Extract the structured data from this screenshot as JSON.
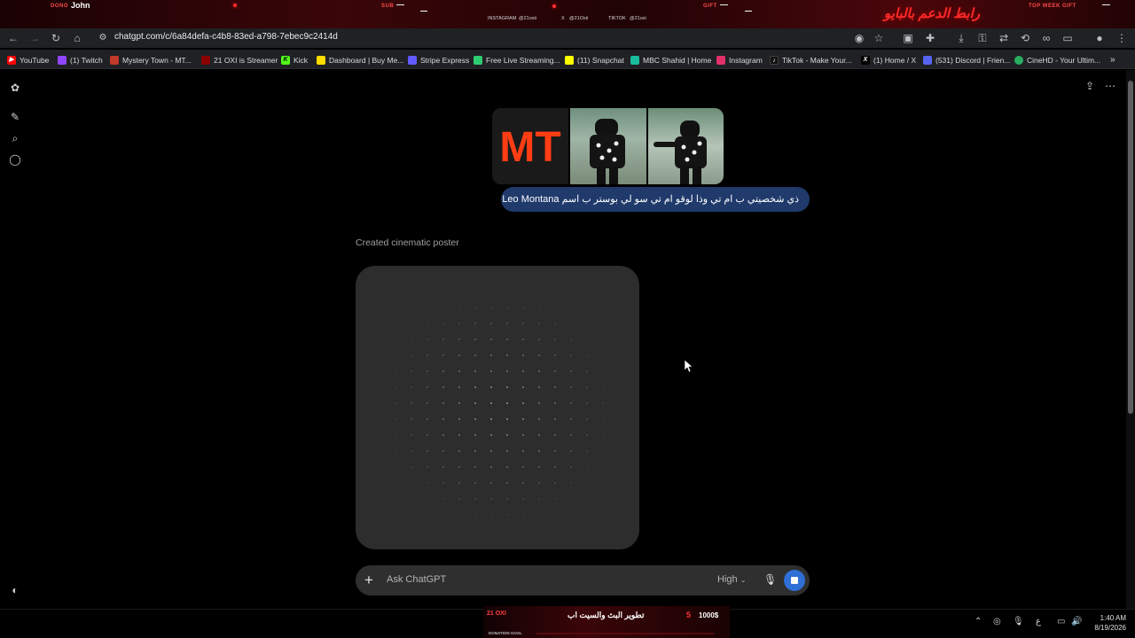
{
  "overlay_top": {
    "items": [
      {
        "label": "DONO",
        "value": "John"
      },
      {
        "label": "SUB",
        "value": "—"
      },
      {
        "label": "GIFT",
        "value": "—"
      },
      {
        "label": "TOP WEEK GIFT",
        "value": "—"
      }
    ],
    "socials": [
      {
        "label": "INSTAGRAM",
        "handle": "@21oxii"
      },
      {
        "label": "X",
        "handle": "@21Oxii"
      },
      {
        "label": "TIKTOK",
        "handle": "@21oxi"
      }
    ],
    "arabic_banner": "رابط الدعم بالبايو"
  },
  "browser": {
    "url": "chatgpt.com/c/6a84defa-c4b8-83ed-a798-7ebec9c2414d",
    "bookmarks": [
      {
        "label": "YouTube",
        "color": "#ff0000",
        "icon": "youtube-icon"
      },
      {
        "label": "(1) Twitch",
        "color": "#9146ff",
        "icon": "twitch-icon"
      },
      {
        "label": "Mystery Town - MT...",
        "color": "#c0392b",
        "icon": "mt-icon"
      },
      {
        "label": "21 OXI is Streamer",
        "color": "#8b0000",
        "icon": "oxi-icon"
      },
      {
        "label": "Kick",
        "color": "#53fc18",
        "icon": "kick-icon"
      },
      {
        "label": "Dashboard | Buy Me...",
        "color": "#ffdd00",
        "icon": "coffee-icon"
      },
      {
        "label": "Stripe Express",
        "color": "#635bff",
        "icon": "stripe-icon"
      },
      {
        "label": "Free Live Streaming...",
        "color": "#2ecc71",
        "icon": "stream-icon"
      },
      {
        "label": "(11) Snapchat",
        "color": "#fffc00",
        "icon": "snapchat-icon"
      },
      {
        "label": "MBC Shahid | Home",
        "color": "#1abc9c",
        "icon": "shahid-icon"
      },
      {
        "label": "Instagram",
        "color": "#e1306c",
        "icon": "instagram-icon"
      },
      {
        "label": "TikTok - Make Your...",
        "color": "#111111",
        "icon": "tiktok-icon"
      },
      {
        "label": "(1) Home / X",
        "color": "#000000",
        "icon": "x-icon"
      },
      {
        "label": "(531) Discord | Frien...",
        "color": "#5865f2",
        "icon": "discord-icon"
      },
      {
        "label": "CineHD - Your Ultim...",
        "color": "#27ae60",
        "icon": "cinehd-icon"
      }
    ]
  },
  "chat": {
    "user_message": "ذي شخصيتي ب ام تي وذا لوقو ام تي سو لي بوستر ب اسم Leo Montana",
    "status": "Created cinematic poster",
    "logo_text": "MT"
  },
  "composer": {
    "placeholder": "Ask ChatGPT",
    "model": "High"
  },
  "overlay_bottom": {
    "left": "21 OXI",
    "title": "تطوير البث والسيت اب",
    "progress": "5",
    "goal": "1000$",
    "goal_label": "DONATION GOAL"
  },
  "taskbar": {
    "time": "1:40 AM",
    "date": "8/19/2026",
    "lang": "ع"
  }
}
